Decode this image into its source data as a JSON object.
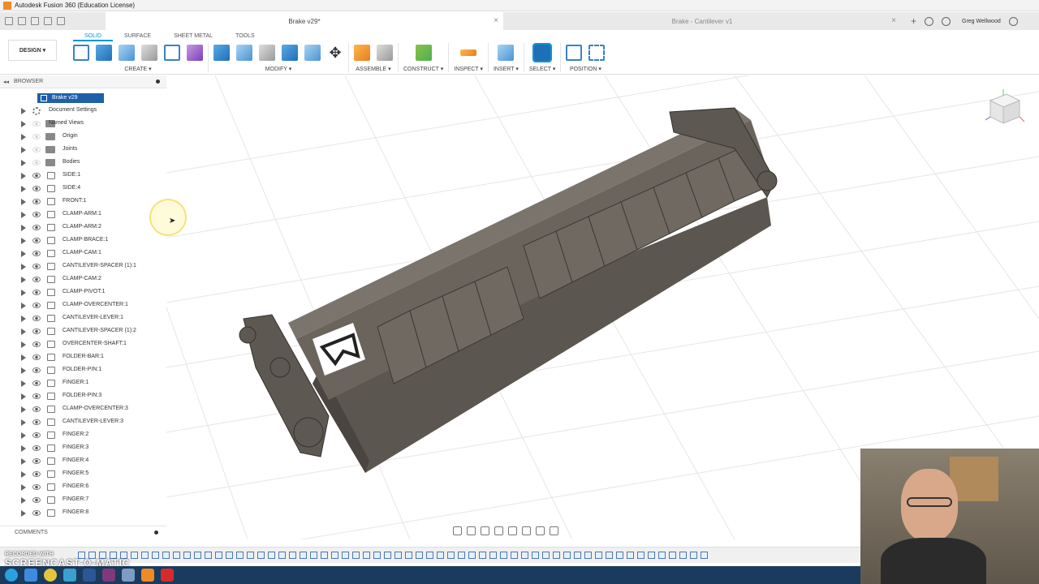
{
  "window": {
    "title": "Autodesk Fusion 360 (Education License)"
  },
  "tabs": [
    {
      "label": "Brake v29*",
      "active": true
    },
    {
      "label": "Brake - Cantilever v1",
      "active": false
    }
  ],
  "user": {
    "name": "Greg Wellwood"
  },
  "workspace": {
    "label": "DESIGN ▾"
  },
  "toolbar_tabs": [
    "SOLID",
    "SURFACE",
    "SHEET METAL",
    "TOOLS"
  ],
  "groups": [
    {
      "label": "CREATE ▾"
    },
    {
      "label": "MODIFY ▾"
    },
    {
      "label": "ASSEMBLE ▾"
    },
    {
      "label": "CONSTRUCT ▾"
    },
    {
      "label": "INSPECT ▾"
    },
    {
      "label": "INSERT ▾"
    },
    {
      "label": "SELECT ▾"
    },
    {
      "label": "POSITION ▾"
    }
  ],
  "browser": {
    "title": "BROWSER",
    "root": "Brake v29",
    "items": [
      {
        "label": "Document Settings",
        "kind": "gear"
      },
      {
        "label": "Named Views",
        "kind": "folder"
      },
      {
        "label": "Origin",
        "kind": "folder"
      },
      {
        "label": "Joints",
        "kind": "folder"
      },
      {
        "label": "Bodies",
        "kind": "folder"
      },
      {
        "label": "SIDE:1",
        "kind": "comp"
      },
      {
        "label": "SIDE:4",
        "kind": "comp"
      },
      {
        "label": "FRONT:1",
        "kind": "comp"
      },
      {
        "label": "CLAMP-ARM:1",
        "kind": "comp"
      },
      {
        "label": "CLAMP-ARM:2",
        "kind": "comp"
      },
      {
        "label": "CLAMP-BRACE:1",
        "kind": "comp"
      },
      {
        "label": "CLAMP-CAM:1",
        "kind": "comp"
      },
      {
        "label": "CANTILEVER-SPACER (1):1",
        "kind": "comp"
      },
      {
        "label": "CLAMP-CAM:2",
        "kind": "comp"
      },
      {
        "label": "CLAMP-PIVOT:1",
        "kind": "comp"
      },
      {
        "label": "CLAMP-OVERCENTER:1",
        "kind": "comp"
      },
      {
        "label": "CANTILEVER-LEVER:1",
        "kind": "comp"
      },
      {
        "label": "CANTILEVER-SPACER (1):2",
        "kind": "comp"
      },
      {
        "label": "OVERCENTER-SHAFT:1",
        "kind": "comp"
      },
      {
        "label": "FOLDER-BAR:1",
        "kind": "comp"
      },
      {
        "label": "FOLDER-PIN:1",
        "kind": "comp"
      },
      {
        "label": "FINGER:1",
        "kind": "comp"
      },
      {
        "label": "FOLDER-PIN:3",
        "kind": "comp"
      },
      {
        "label": "CLAMP-OVERCENTER:3",
        "kind": "comp"
      },
      {
        "label": "CANTILEVER-LEVER:3",
        "kind": "comp"
      },
      {
        "label": "FINGER:2",
        "kind": "comp"
      },
      {
        "label": "FINGER:3",
        "kind": "comp"
      },
      {
        "label": "FINGER:4",
        "kind": "comp"
      },
      {
        "label": "FINGER:5",
        "kind": "comp"
      },
      {
        "label": "FINGER:6",
        "kind": "comp"
      },
      {
        "label": "FINGER:7",
        "kind": "comp"
      },
      {
        "label": "FINGER:8",
        "kind": "comp"
      }
    ]
  },
  "comments": {
    "label": "COMMENTS"
  },
  "watermark": {
    "line1": "RECORDED WITH",
    "line2": "SCREENCAST-O-MATIC"
  },
  "colors": {
    "accent": "#0696d7",
    "selection": "#1f5fa8",
    "model": "#5b5650"
  }
}
